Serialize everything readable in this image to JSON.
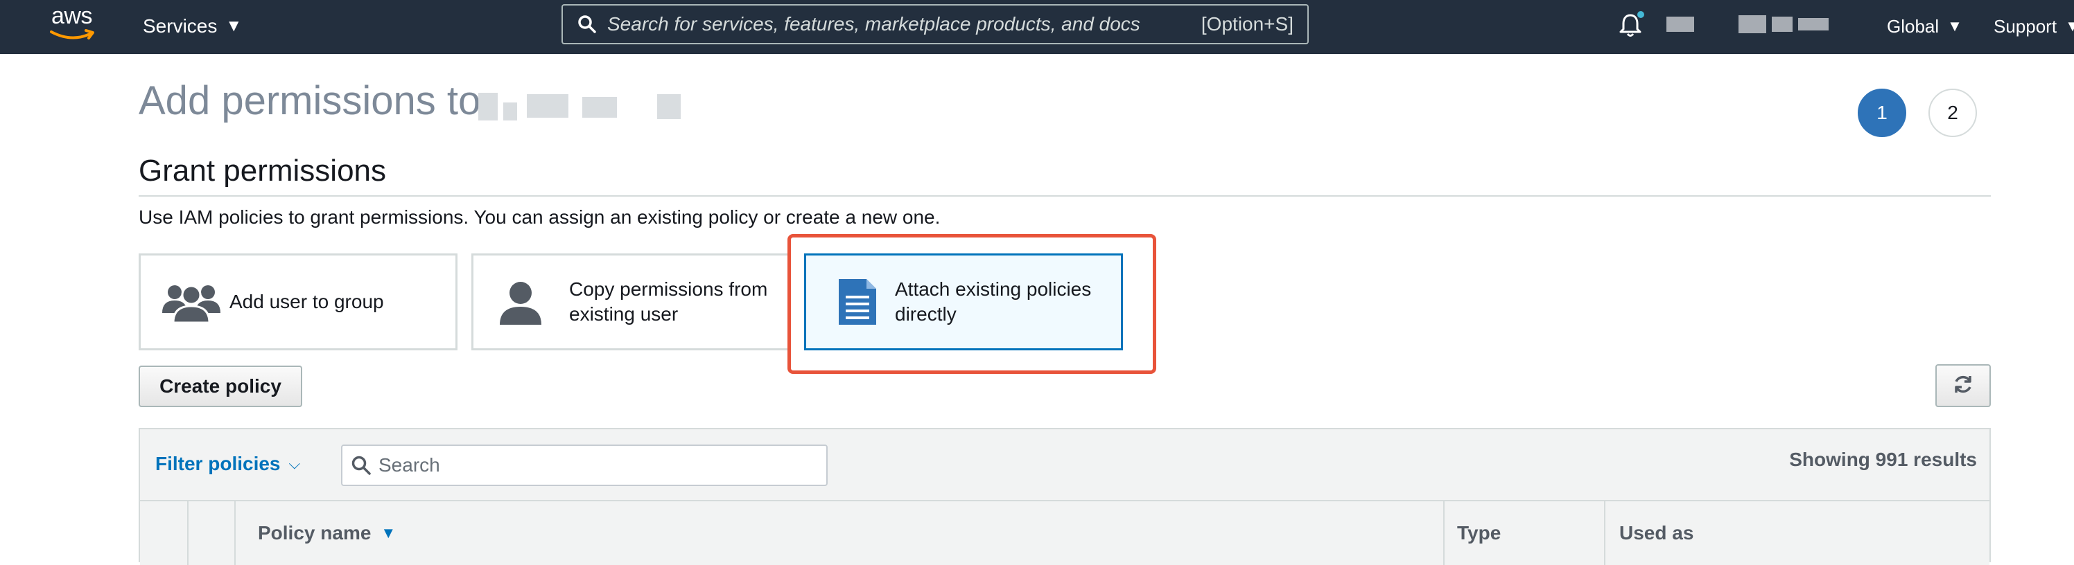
{
  "navbar": {
    "logo_text": "aws",
    "services_label": "Services",
    "search_placeholder": "Search for services, features, marketplace products, and docs",
    "search_shortcut": "[Option+S]",
    "region_label": "Global",
    "support_label": "Support",
    "icons": [
      "aws-logo",
      "caret-down-icon",
      "search-icon",
      "bell-icon"
    ],
    "colors": {
      "bar": "#232f3e",
      "notification_dot": "#44b9d6"
    }
  },
  "page": {
    "title_prefix": "Add permissions to",
    "steps": [
      "1",
      "2"
    ],
    "active_step": "1"
  },
  "grant": {
    "title": "Grant permissions",
    "description": "Use IAM policies to grant permissions. You can assign an existing policy or create a new one.",
    "options": [
      {
        "label": "Add user to group",
        "icon": "group-icon"
      },
      {
        "label_line1": "Copy permissions from",
        "label_line2": "existing user",
        "icon": "user-icon"
      },
      {
        "label_line1": "Attach existing policies",
        "label_line2": "directly",
        "icon": "document-icon",
        "selected": true
      }
    ],
    "highlight_color": "#e8533a"
  },
  "actions": {
    "create_policy_label": "Create policy",
    "refresh_icon": "refresh-icon"
  },
  "table": {
    "filter_label": "Filter policies",
    "search_placeholder": "Search",
    "results_text": "Showing 991 results",
    "columns": [
      "Policy name",
      "Type",
      "Used as"
    ],
    "sorted_column": "Policy name"
  }
}
